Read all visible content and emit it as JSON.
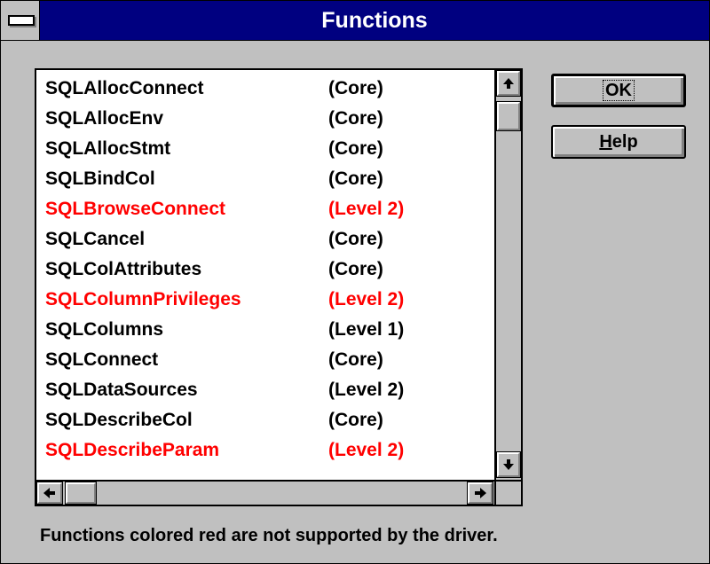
{
  "window": {
    "title": "Functions"
  },
  "buttons": {
    "ok_label": "OK",
    "help_label": "Help",
    "help_mnemonic": "H"
  },
  "functions": [
    {
      "name": "SQLAllocConnect",
      "level": "(Core)",
      "color": "#000000",
      "supported": true
    },
    {
      "name": "SQLAllocEnv",
      "level": "(Core)",
      "color": "#000000",
      "supported": true
    },
    {
      "name": "SQLAllocStmt",
      "level": "(Core)",
      "color": "#000000",
      "supported": true
    },
    {
      "name": "SQLBindCol",
      "level": "(Core)",
      "color": "#000000",
      "supported": true
    },
    {
      "name": "SQLBrowseConnect",
      "level": "(Level 2)",
      "color": "#ff0000",
      "supported": false
    },
    {
      "name": "SQLCancel",
      "level": "(Core)",
      "color": "#000000",
      "supported": true
    },
    {
      "name": "SQLColAttributes",
      "level": "(Core)",
      "color": "#000000",
      "supported": true
    },
    {
      "name": "SQLColumnPrivileges",
      "level": "(Level 2)",
      "color": "#ff0000",
      "supported": false
    },
    {
      "name": "SQLColumns",
      "level": "(Level 1)",
      "color": "#000000",
      "supported": true
    },
    {
      "name": "SQLConnect",
      "level": "(Core)",
      "color": "#000000",
      "supported": true
    },
    {
      "name": "SQLDataSources",
      "level": "(Level 2)",
      "color": "#000000",
      "supported": true
    },
    {
      "name": "SQLDescribeCol",
      "level": "(Core)",
      "color": "#000000",
      "supported": true
    },
    {
      "name": "SQLDescribeParam",
      "level": "(Level 2)",
      "color": "#ff0000",
      "supported": false
    }
  ],
  "status_text": "Functions colored red are not supported by the driver.",
  "icons": {
    "system_menu": "system-menu-icon",
    "scroll_up": "arrow-up-icon",
    "scroll_down": "arrow-down-icon",
    "scroll_left": "arrow-left-icon",
    "scroll_right": "arrow-right-icon"
  },
  "colors": {
    "titlebar": "#000080",
    "unsupported": "#ff0000",
    "supported": "#000000",
    "dialog": "#c0c0c0"
  }
}
